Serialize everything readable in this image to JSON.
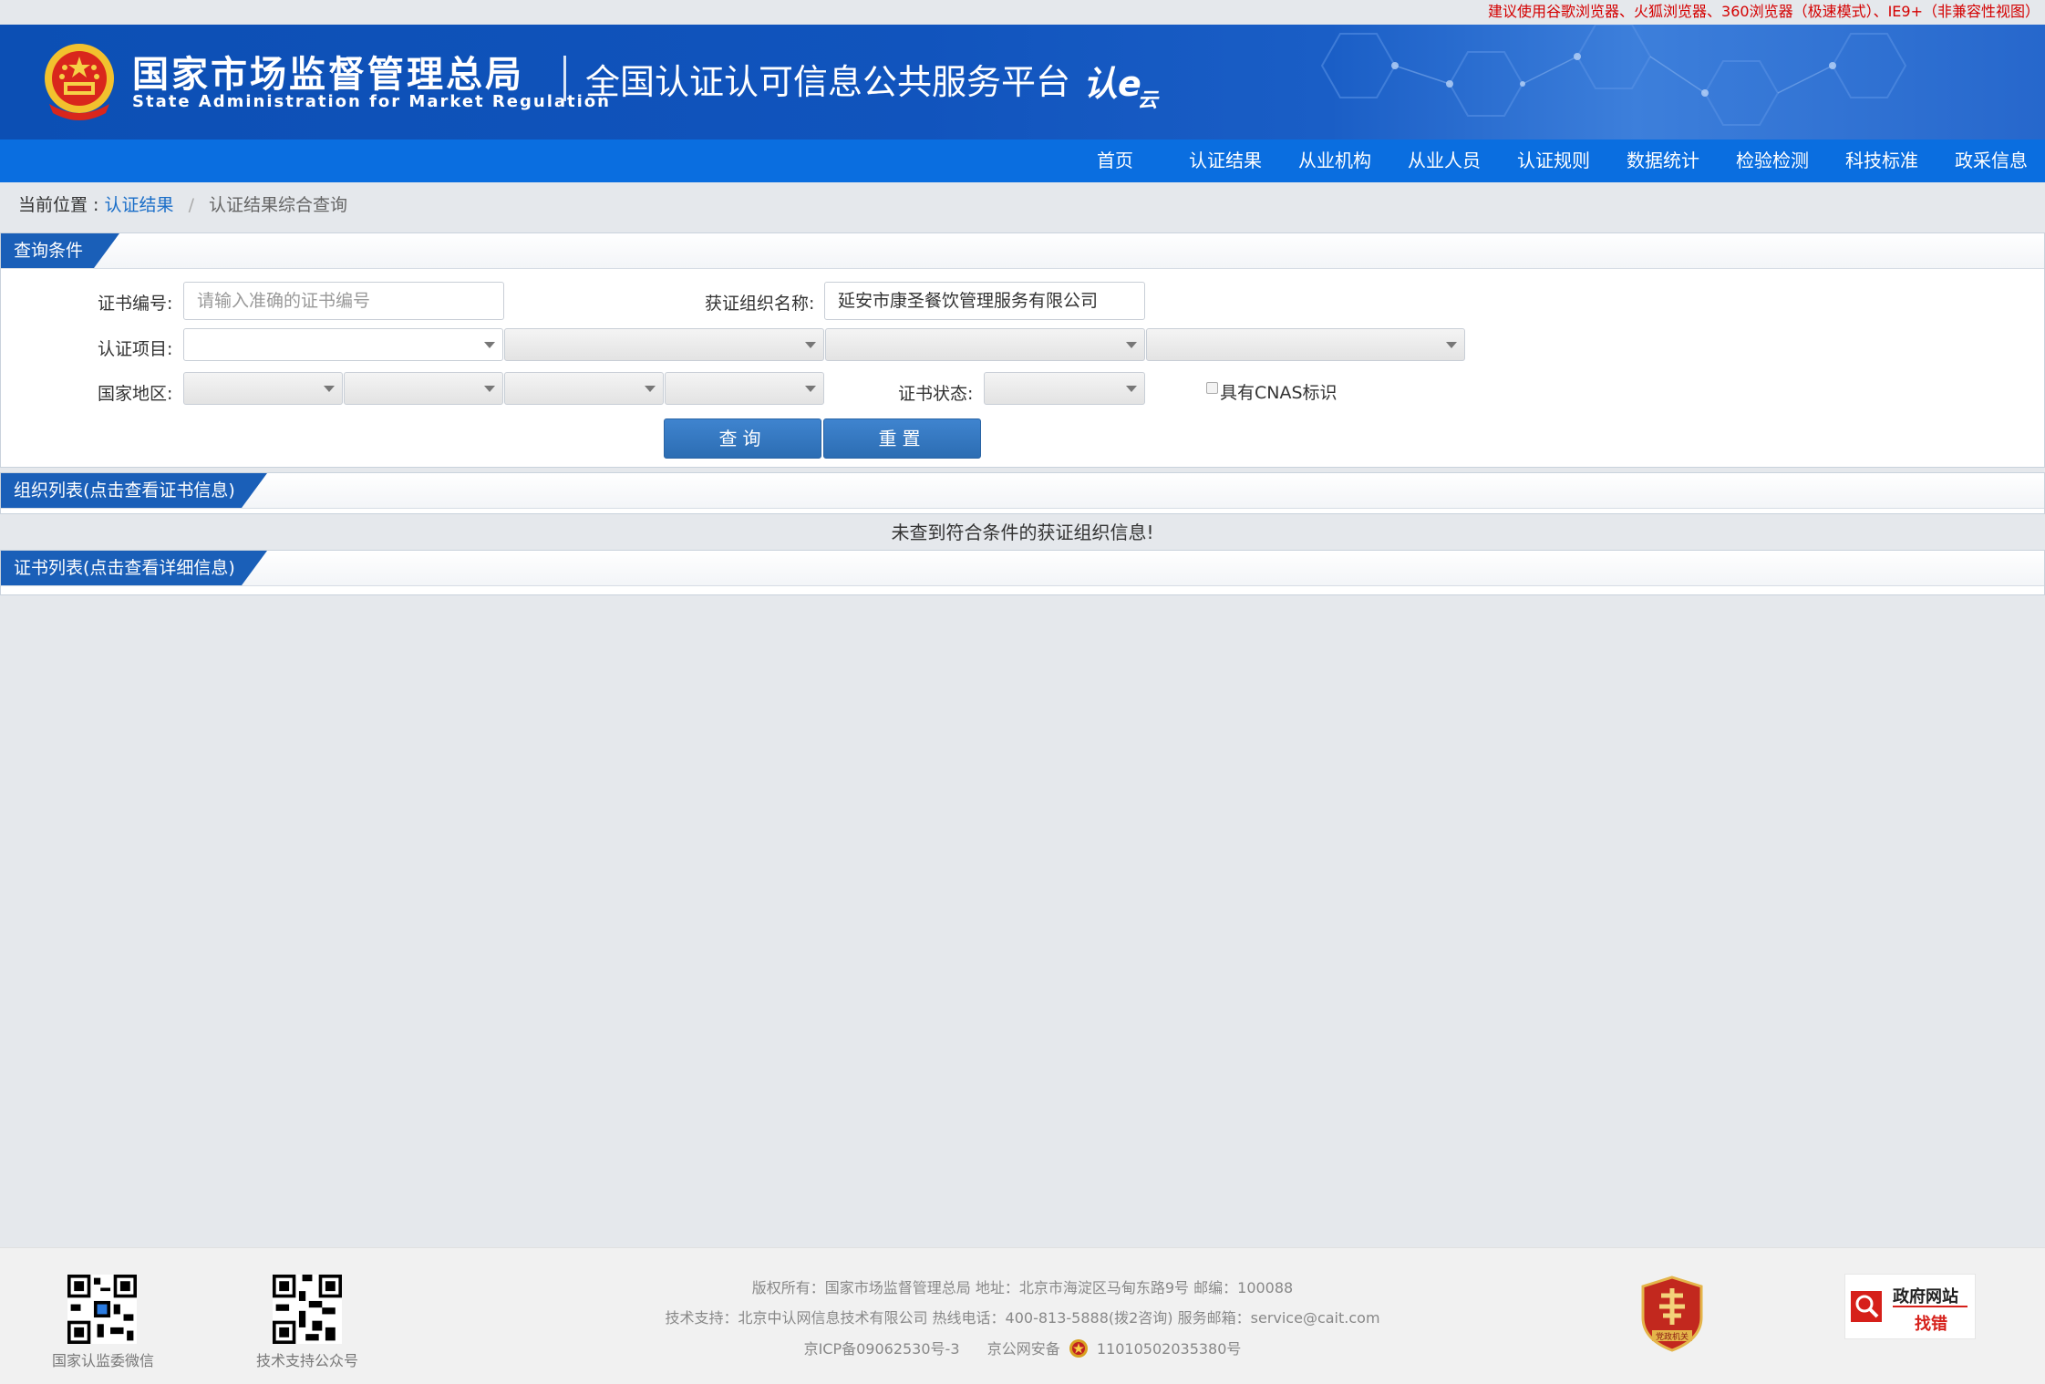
{
  "header": {
    "browser_notice": "建议使用谷歌浏览器、火狐浏览器、360浏览器（极速模式）、IE9+（非兼容性视图）",
    "org_name_cn": "国家市场监督管理总局",
    "org_name_en": "State Administration  for  Market Regulation",
    "platform_name": "全国认证认可信息公共服务平台",
    "platform_logo_main": "认e",
    "platform_logo_sub": "云",
    "emblem_icon": "national-emblem-icon"
  },
  "nav": {
    "items": [
      "首页",
      "认证结果",
      "从业机构",
      "从业人员",
      "认证规则",
      "数据统计",
      "检验检测",
      "科技标准",
      "政采信息"
    ]
  },
  "breadcrumb": {
    "prefix": "当前位置 :",
    "link": "认证结果",
    "separator": "/",
    "current": "认证结果综合查询"
  },
  "query_panel": {
    "title": "查询条件",
    "cert_no_label": "证书编号:",
    "cert_no_placeholder": "请输入准确的证书编号",
    "cert_no_value": "",
    "org_name_label": "获证组织名称:",
    "org_name_value": "延安市康圣餐饮管理服务有限公司",
    "project_label": "认证项目:",
    "region_label": "国家地区:",
    "status_label": "证书状态:",
    "cnas_label": "具有CNAS标识",
    "cnas_checked": false,
    "search_button": "查询",
    "reset_button": "重置"
  },
  "org_list": {
    "title": "组织列表(点击查看证书信息)",
    "empty_message": "未查到符合条件的获证组织信息!"
  },
  "cert_list": {
    "title": "证书列表(点击查看详细信息)"
  },
  "footer": {
    "qr_left_caption": "国家认监委微信",
    "qr_right_caption": "技术支持公众号",
    "line1": "版权所有：国家市场监督管理总局    地址：北京市海淀区马甸东路9号    邮编：100088",
    "line2": "技术支持：北京中认网信息技术有限公司    热线电话：400-813-5888(拨2咨询)    服务邮箱：service@cait.com",
    "icp": "京ICP备09062530号-3",
    "police_prefix": "京公网安备",
    "police_no": "11010502035380号",
    "party_badge_text": "党政机关",
    "find_error_title": "政府网站",
    "find_error_sub": "找错"
  },
  "colors": {
    "nav_bg": "#0a6ee0",
    "banner_bg": "#1154bd",
    "tab_bg": "#1a5fb8",
    "button_bg": "#2c6db3",
    "notice_red": "#d40000",
    "link_blue": "#1a6ec8"
  }
}
